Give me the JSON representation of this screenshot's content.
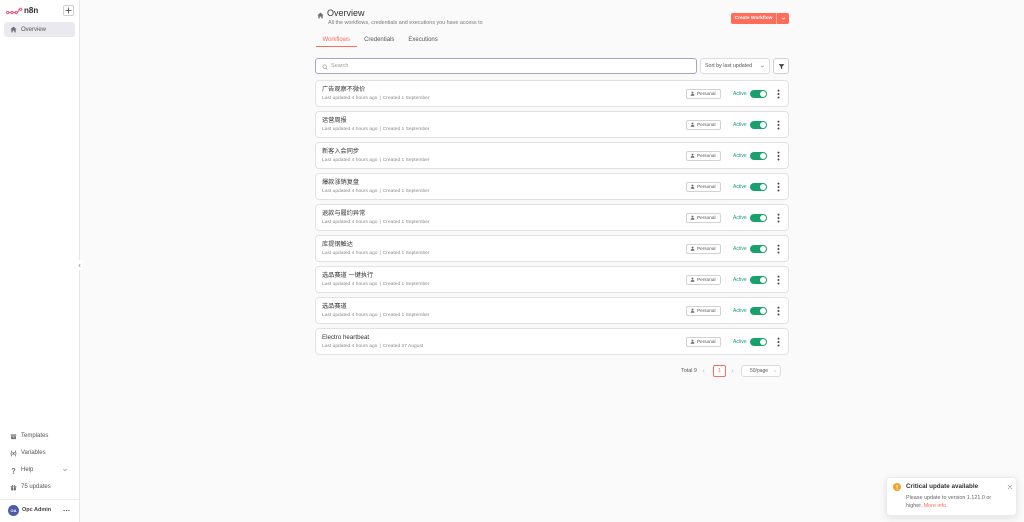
{
  "app": {
    "logo_text": "n8n"
  },
  "colors": {
    "accent": "#ff6d5a",
    "success": "#1aa06d",
    "warning": "#f2a32e",
    "avatar": "#4b5ca6",
    "brand": "#ea4b71"
  },
  "sidebar": {
    "nav": [
      {
        "label": "Overview",
        "icon": "home-icon",
        "active": true
      }
    ],
    "footer_items": [
      {
        "label": "Templates",
        "icon": "templates-icon"
      },
      {
        "label": "Variables",
        "icon": "variables-icon"
      },
      {
        "label": "Help",
        "icon": "help-icon"
      },
      {
        "label": "75 updates",
        "icon": "gift-icon"
      }
    ],
    "user": {
      "initials": "OA",
      "name": "Opc Admin"
    }
  },
  "header": {
    "title": "Overview",
    "subtitle": "All the workflows, credentials and executions you have access to",
    "create_label": "Create Workflow"
  },
  "tabs": [
    {
      "label": "Workflows",
      "active": true
    },
    {
      "label": "Credentials",
      "active": false
    },
    {
      "label": "Executions",
      "active": false
    }
  ],
  "toolbar": {
    "search_placeholder": "Search",
    "sort_value": "Sort by last updated"
  },
  "meta_separator": "|",
  "workflows": [
    {
      "name": "广告观察不微价",
      "updated": "Last updated 4 hours ago",
      "created": "Created 1 September",
      "owner": "Personal",
      "status": "Active",
      "active": true
    },
    {
      "name": "运营周报",
      "updated": "Last updated 4 hours ago",
      "created": "Created 1 September",
      "owner": "Personal",
      "status": "Active",
      "active": true
    },
    {
      "name": "新客入会同步",
      "updated": "Last updated 4 hours ago",
      "created": "Created 1 September",
      "owner": "Personal",
      "status": "Active",
      "active": true
    },
    {
      "name": "爆款涨销复盘",
      "updated": "Last updated 4 hours ago",
      "created": "Created 1 September",
      "owner": "Personal",
      "status": "Active",
      "active": true
    },
    {
      "name": "退款与履约异常",
      "updated": "Last updated 4 hours ago",
      "created": "Created 1 September",
      "owner": "Personal",
      "status": "Active",
      "active": true
    },
    {
      "name": "库提钢触达",
      "updated": "Last updated 4 hours ago",
      "created": "Created 1 September",
      "owner": "Personal",
      "status": "Active",
      "active": true
    },
    {
      "name": "选品赛道 一键执行",
      "updated": "Last updated 4 hours ago",
      "created": "Created 1 September",
      "owner": "Personal",
      "status": "Active",
      "active": true
    },
    {
      "name": "选品赛道",
      "updated": "Last updated 4 hours ago",
      "created": "Created 1 September",
      "owner": "Personal",
      "status": "Active",
      "active": true
    },
    {
      "name": "Electro heartbeat",
      "updated": "Last updated 4 hours ago",
      "created": "Created 27 August",
      "owner": "Personal",
      "status": "Active",
      "active": true
    }
  ],
  "pagination": {
    "total": "Total 9",
    "current": "1",
    "page_size": "50/page"
  },
  "toast": {
    "title": "Critical update available",
    "message": "Please update to version 1.121.0 or higher.",
    "link": "More info."
  }
}
